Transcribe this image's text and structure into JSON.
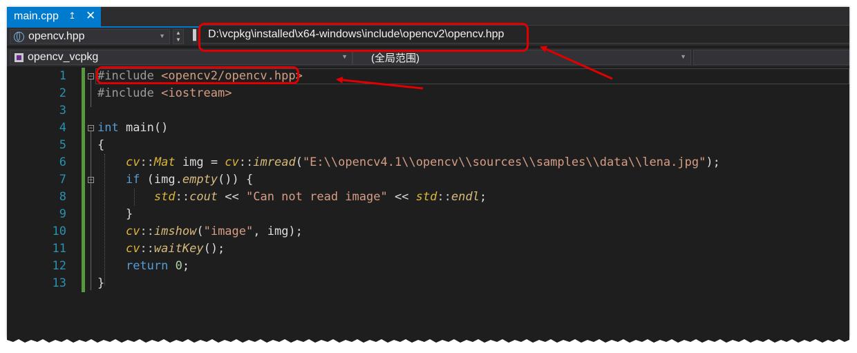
{
  "tab": {
    "title": "main.cpp",
    "pin_glyph": "↥",
    "close_glyph": "✕"
  },
  "nav": {
    "file_combo": "opencv.hpp",
    "project_combo": "opencv_vcpkg",
    "scope_combo": "(全局范围)",
    "path_tooltip": "D:\\vcpkg\\installed\\x64-windows\\include\\opencv2\\opencv.hpp"
  },
  "line_numbers": [
    "1",
    "2",
    "3",
    "4",
    "5",
    "6",
    "7",
    "8",
    "9",
    "10",
    "11",
    "12",
    "13"
  ],
  "code": {
    "l1_a": "#include ",
    "l1_b": "<opencv2/opencv.hpp>",
    "l2_a": "#include ",
    "l2_b": "<iostream>",
    "l4_a": "int",
    "l4_b": " main()",
    "l5": "{",
    "l6_cv1": "cv",
    "l6_sep1": "::",
    "l6_mat": "Mat",
    "l6_mid": " img = ",
    "l6_cv2": "cv",
    "l6_sep2": "::",
    "l6_imread": "imread",
    "l6_open": "(",
    "l6_str": "\"E:\\\\opencv4.1\\\\opencv\\\\sources\\\\samples\\\\data\\\\lena.jpg\"",
    "l6_close": ");",
    "l7_if": "if",
    "l7_a": " (img.",
    "l7_empty": "empty",
    "l7_b": "()) {",
    "l8_std1": "std",
    "l8_sep1": "::",
    "l8_cout": "cout",
    "l8_op1": " << ",
    "l8_str": "\"Can not read image\"",
    "l8_op2": " << ",
    "l8_std2": "std",
    "l8_sep2": "::",
    "l8_endl": "endl",
    "l8_semi": ";",
    "l9": "}",
    "l10_cv": "cv",
    "l10_sep": "::",
    "l10_fn": "imshow",
    "l10_open": "(",
    "l10_str": "\"image\"",
    "l10_rest": ", img);",
    "l11_cv": "cv",
    "l11_sep": "::",
    "l11_fn": "waitKey",
    "l11_rest": "();",
    "l12_kw": "return",
    "l12_sp": " ",
    "l12_num": "0",
    "l12_semi": ";",
    "l13": "}"
  },
  "colors": {
    "accent": "#007acc",
    "annotation": "#e00000",
    "line_number": "#2b91af",
    "keyword": "#569cd6",
    "string": "#d69d85"
  },
  "icons": [
    "globe-icon",
    "project-icon",
    "pin-icon",
    "close-icon",
    "dropdown-arrow-icon"
  ]
}
